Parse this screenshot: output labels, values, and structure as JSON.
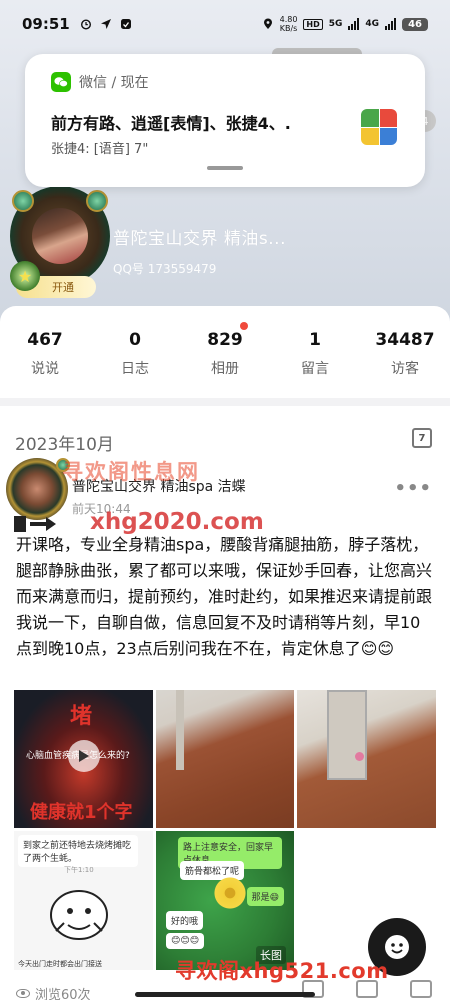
{
  "status_bar": {
    "time": "09:51",
    "net_speed_value": "4.80",
    "net_speed_unit": "KB/s",
    "hd_label": "HD",
    "net_5g": "5G",
    "net_4g": "4G",
    "battery": "46"
  },
  "notification": {
    "app_name": "微信 / 现在",
    "title": "前方有路、逍遥[表情]、张捷4、.",
    "body": "张捷4: [语音] 7\""
  },
  "side_badge": "4",
  "profile": {
    "name": "普陀宝山交界 精油s...",
    "qq": "QQ号 173559479",
    "vip_label": "开通"
  },
  "stats": [
    {
      "value": "467",
      "label": "说说"
    },
    {
      "value": "0",
      "label": "日志"
    },
    {
      "value": "829",
      "label": "相册"
    },
    {
      "value": "1",
      "label": "留言"
    },
    {
      "value": "34487",
      "label": "访客"
    }
  ],
  "feed": {
    "date": "2023年10月",
    "calendar_day": "7",
    "post": {
      "author": "普陀宝山交界 精油spa 洁蝶",
      "time": "前天10:44",
      "text": "开课咯，专业全身精油spa，腰酸背痛腿抽筋，脖子落枕，腿部静脉曲张，累了都可以来哦，保证妙手回春，让您高兴而来满意而归，提前预约，准时赴约，如果推迟来请提前跟我说一下，自聊自做，信息回复不及时请稍等片刻，早10点到晚10点，23点后别问我在不在，肯定休息了😊😊",
      "views": "浏览60次"
    },
    "images": {
      "img1_top": "堵",
      "img1_mid": "心脑血管疾病是怎么来的?",
      "img1_bottom": "健康就1个字",
      "img4_caption": "到家之前还特地去烧烤摊吃了两个生蚝。",
      "img4_time": "下午1:10",
      "img4_bottom": "今天出门走时都会出门接送",
      "img5_bubble1": "路上注意安全，回家早点休息",
      "img5_bubble2": "筋骨都松了呢",
      "img5_bubble3": "那是😄",
      "img5_bubble4": "好的哦",
      "img5_bubble5": "😊😊😊",
      "long_image_label": "长图"
    }
  },
  "watermarks": {
    "top": "寻欢阁性息网",
    "mid": "xhg2020.com",
    "bottom": "寻欢阁xhg521.com"
  }
}
